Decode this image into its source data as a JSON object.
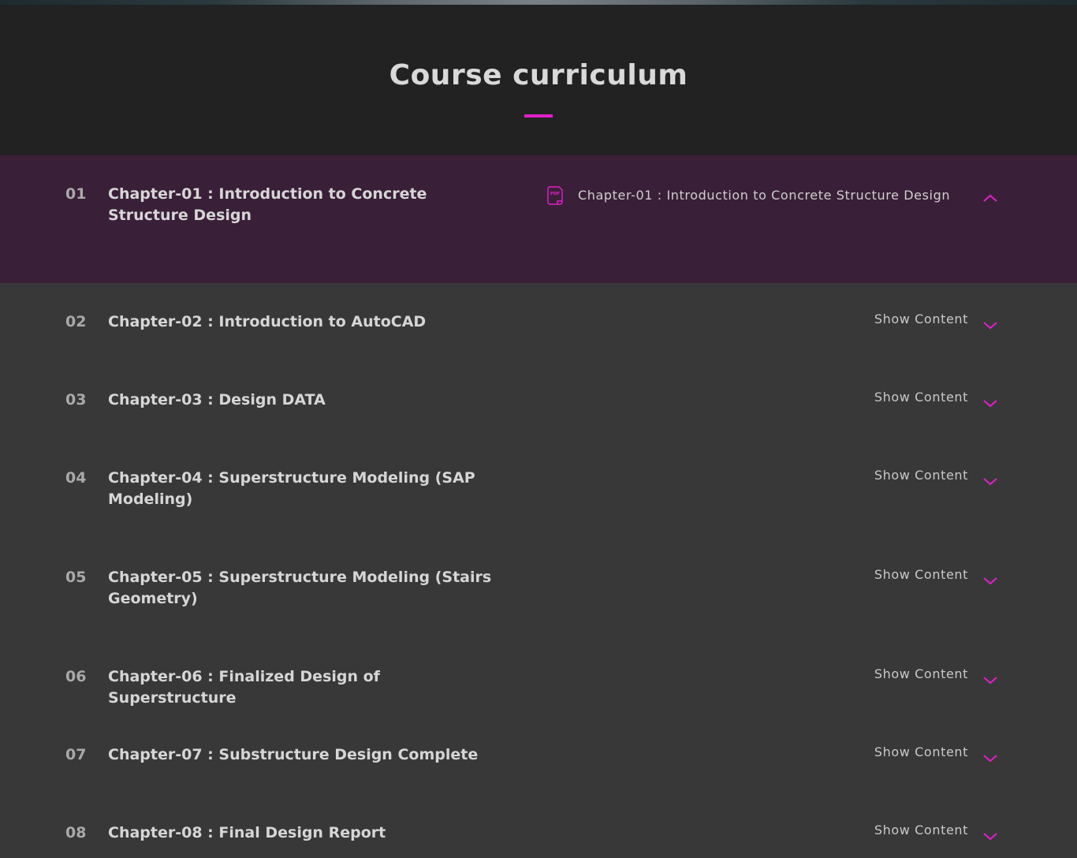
{
  "section": {
    "title": "Course curriculum",
    "accent_color": "#e020c8"
  },
  "chapters": [
    {
      "number": "01",
      "title": "Chapter-01 : Introduction to Concrete Structure Design",
      "expanded": true,
      "lessons": [
        {
          "icon": "pdf-file-icon",
          "title": "Chapter-01 : Introduction to Concrete Structure Design"
        }
      ]
    },
    {
      "number": "02",
      "title": "Chapter-02 : Introduction to AutoCAD",
      "toggle_label": "Show Content",
      "expanded": false
    },
    {
      "number": "03",
      "title": "Chapter-03 : Design DATA",
      "toggle_label": "Show Content",
      "expanded": false
    },
    {
      "number": "04",
      "title": "Chapter-04 : Superstructure Modeling (SAP Modeling)",
      "toggle_label": "Show Content",
      "expanded": false
    },
    {
      "number": "05",
      "title": "Chapter-05 : Superstructure Modeling (Stairs Geometry)",
      "toggle_label": "Show Content",
      "expanded": false
    },
    {
      "number": "06",
      "title": "Chapter-06 : Finalized Design of Superstructure",
      "toggle_label": "Show Content",
      "expanded": false
    },
    {
      "number": "07",
      "title": "Chapter-07 : Substructure Design Complete",
      "toggle_label": "Show Content",
      "expanded": false
    },
    {
      "number": "08",
      "title": "Chapter-08 : Final Design Report",
      "toggle_label": "Show Content",
      "expanded": false
    }
  ]
}
